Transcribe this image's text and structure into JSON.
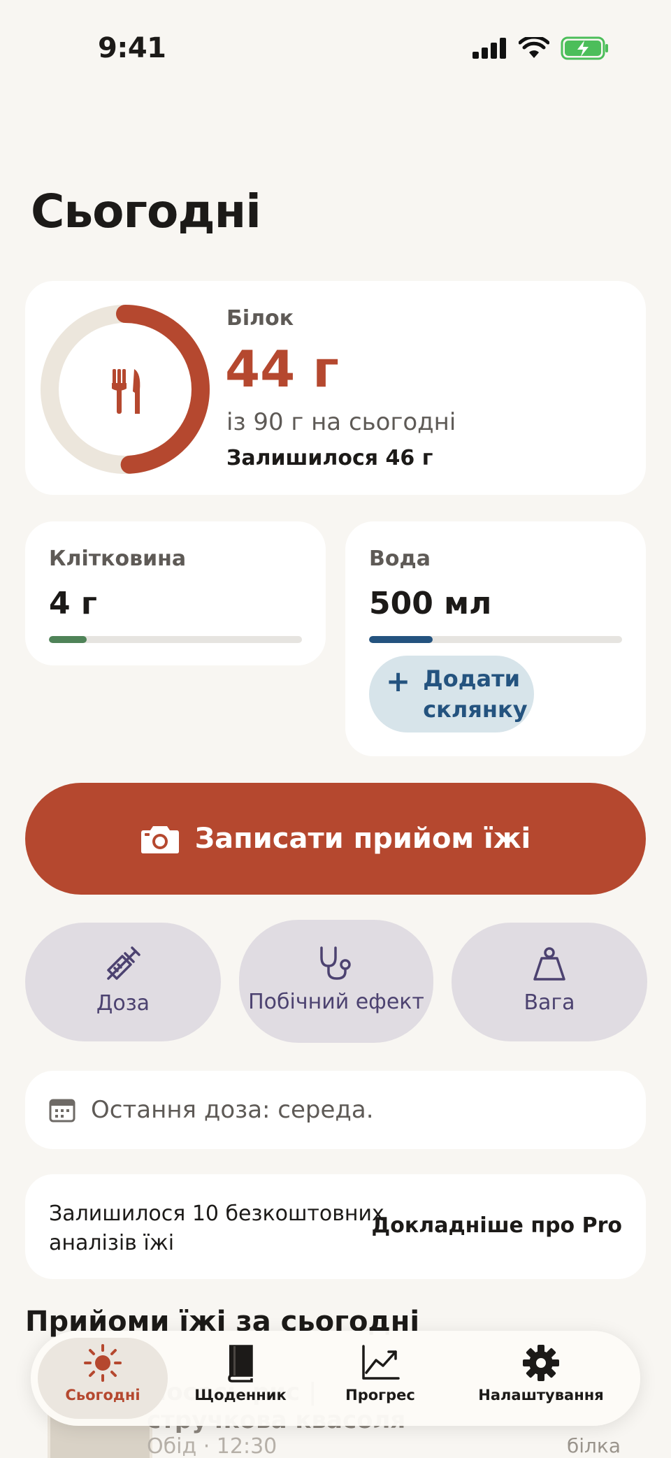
{
  "status_bar": {
    "time": "9:41"
  },
  "page_title": "Сьогодні",
  "protein": {
    "label": "Білок",
    "value": "44 г",
    "goal_text": "із 90 г на сьогодні",
    "remaining_text": "Залишилося 46 г",
    "progress_fraction": 0.49
  },
  "fiber": {
    "label": "Клітковина",
    "value": "4 г",
    "progress_fraction": 0.15
  },
  "water": {
    "label": "Вода",
    "value": "500 мл",
    "progress_fraction": 0.25,
    "add_button_label": "Додати склянку"
  },
  "log_meal_button": {
    "label": "Записати прийом їжі"
  },
  "quick_actions": [
    {
      "label": "Доза",
      "icon": "syringe-icon"
    },
    {
      "label": "Побічний ефект",
      "icon": "stethoscope-icon"
    },
    {
      "label": "Вага",
      "icon": "weight-icon"
    }
  ],
  "last_dose": {
    "text": "Остання доза: середа."
  },
  "pro_banner": {
    "text": "Залишилося 10 безкоштовних аналізів їжі",
    "link_label": "Докладніше про Pro"
  },
  "meals_section": {
    "heading": "Прийоми їжі за сьогодні",
    "items": [
      {
        "name": "Лосось-рис | стручкова квасоля",
        "time": "Обід · 12:30",
        "protein_label": "білка"
      }
    ]
  },
  "tab_bar": {
    "tabs": [
      {
        "label": "Сьогодні",
        "active": true
      },
      {
        "label": "Щоденник",
        "active": false
      },
      {
        "label": "Прогрес",
        "active": false
      },
      {
        "label": "Налаштування",
        "active": false
      }
    ]
  },
  "colors": {
    "accent": "#b5482f",
    "fiber": "#4f8358",
    "water": "#24537f",
    "background": "#f8f6f2",
    "quick_action_bg": "#e0dce2"
  }
}
